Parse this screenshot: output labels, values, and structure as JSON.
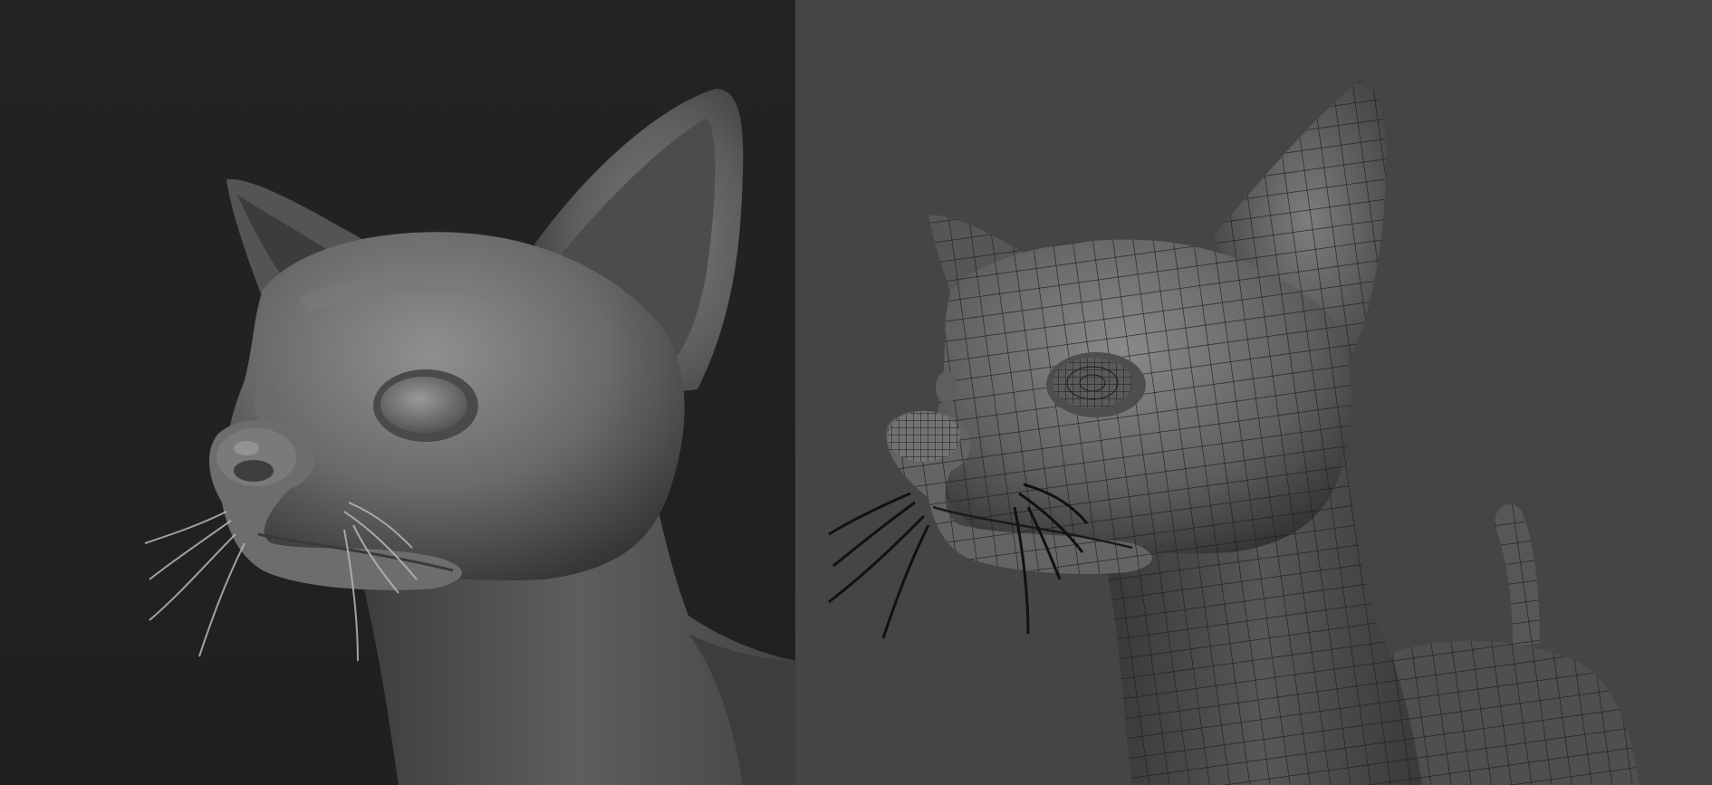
{
  "panels": [
    {
      "id": "left",
      "shading": "smooth-clay",
      "background": "#232323",
      "surface_light": "#8d8d8d",
      "surface_dark": "#2e2e2e"
    },
    {
      "id": "right",
      "shading": "wireframe-topology",
      "background": "#454545",
      "surface_light": "#8a8a8a",
      "surface_dark": "#262626",
      "wire_color": "#1a1a1a"
    }
  ]
}
